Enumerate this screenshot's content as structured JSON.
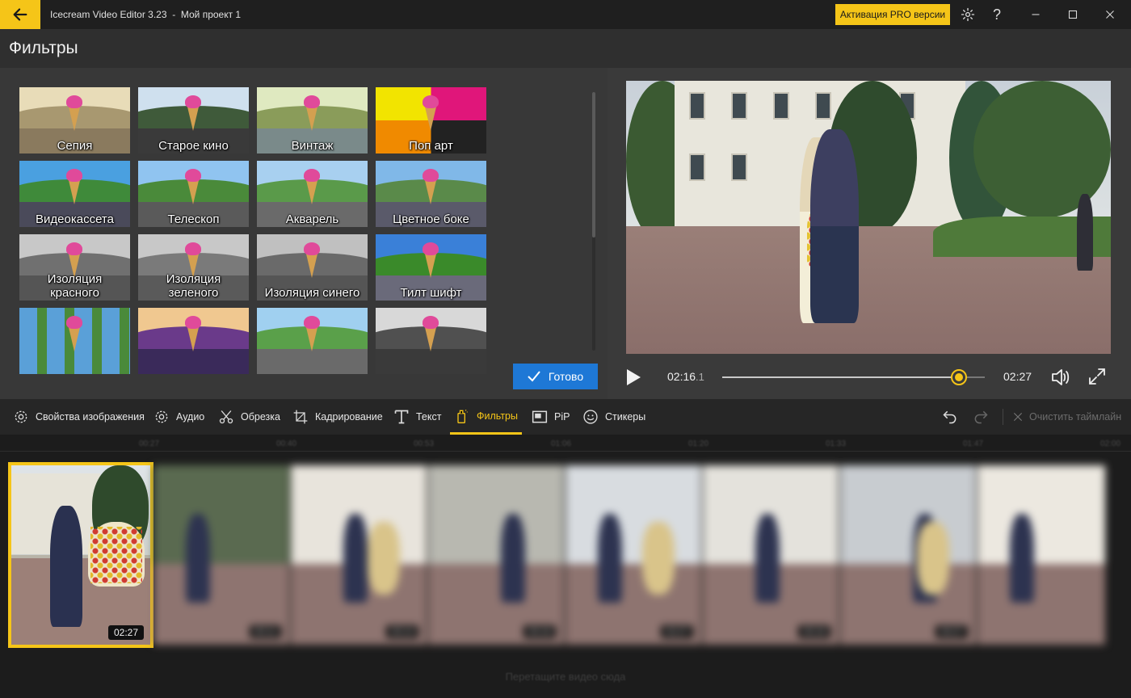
{
  "titlebar": {
    "app_title": "Icecream Video Editor 3.23  -  Мой проект 1",
    "pro_button": "Активация PRO версии",
    "help_label": "?"
  },
  "page": {
    "title": "Фильтры"
  },
  "filters": {
    "items": [
      {
        "label": "Сепия"
      },
      {
        "label": "Старое кино"
      },
      {
        "label": "Винтаж"
      },
      {
        "label": "Поп арт"
      },
      {
        "label": "Видеокассета"
      },
      {
        "label": "Телескоп"
      },
      {
        "label": "Акварель"
      },
      {
        "label": "Цветное боке"
      },
      {
        "label": "Изоляция красного"
      },
      {
        "label": "Изоляция зеленого"
      },
      {
        "label": "Изоляция синего"
      },
      {
        "label": "Тилт шифт"
      },
      {
        "label": ""
      },
      {
        "label": ""
      },
      {
        "label": ""
      },
      {
        "label": ""
      }
    ],
    "done_button": "Готово"
  },
  "player": {
    "current_time": "02:16",
    "current_ms": ".1",
    "total_time": "02:27",
    "progress": 0.9
  },
  "toolbar": {
    "items": [
      {
        "label": "Свойства изображения",
        "icon": "gear-icon"
      },
      {
        "label": "Аудио",
        "icon": "audio-gear-icon"
      },
      {
        "label": "Обрезка",
        "icon": "scissors-icon"
      },
      {
        "label": "Кадрирование",
        "icon": "crop-icon"
      },
      {
        "label": "Текст",
        "icon": "text-icon"
      },
      {
        "label": "Фильтры",
        "icon": "filter-icon"
      },
      {
        "label": "PiP",
        "icon": "pip-icon"
      },
      {
        "label": "Стикеры",
        "icon": "smiley-icon"
      }
    ],
    "clear_label": "Очистить таймлайн"
  },
  "timeline": {
    "ruler_ticks": [
      "00:27",
      "00:40",
      "00:53",
      "01:06",
      "01:20",
      "01:33",
      "01:47",
      "02:00"
    ],
    "selected_clip_time": "02:27",
    "clip_times": [
      "00:11",
      "00:14",
      "00:16",
      "02:27",
      "00:16",
      "00:27"
    ],
    "drop_hint": "Перетащите видео сюда"
  },
  "colors": {
    "accent": "#f5c518",
    "primary_button": "#1e78d6"
  }
}
